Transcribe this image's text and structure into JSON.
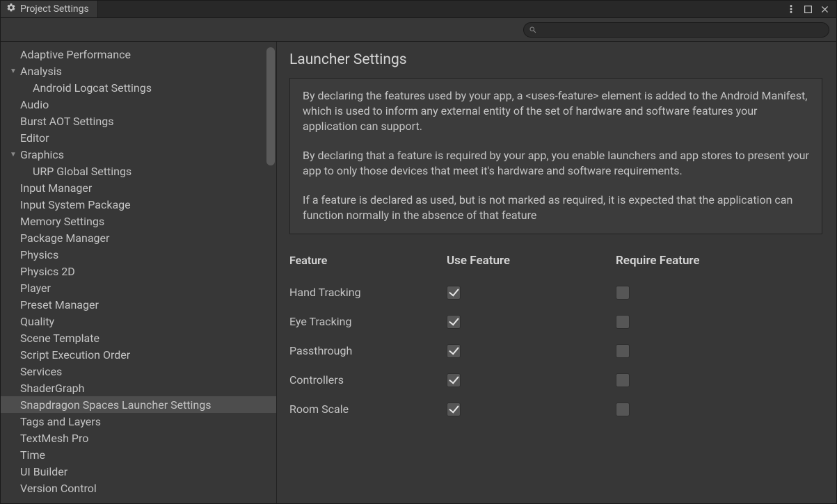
{
  "window": {
    "title": "Project Settings"
  },
  "search": {
    "value": "",
    "placeholder": ""
  },
  "sidebar": {
    "items": [
      {
        "label": "Adaptive Performance",
        "depth": 0,
        "expandable": false,
        "selected": false
      },
      {
        "label": "Analysis",
        "depth": 0,
        "expandable": true,
        "selected": false
      },
      {
        "label": "Android Logcat Settings",
        "depth": 1,
        "expandable": false,
        "selected": false
      },
      {
        "label": "Audio",
        "depth": 0,
        "expandable": false,
        "selected": false
      },
      {
        "label": "Burst AOT Settings",
        "depth": 0,
        "expandable": false,
        "selected": false
      },
      {
        "label": "Editor",
        "depth": 0,
        "expandable": false,
        "selected": false
      },
      {
        "label": "Graphics",
        "depth": 0,
        "expandable": true,
        "selected": false
      },
      {
        "label": "URP Global Settings",
        "depth": 1,
        "expandable": false,
        "selected": false
      },
      {
        "label": "Input Manager",
        "depth": 0,
        "expandable": false,
        "selected": false
      },
      {
        "label": "Input System Package",
        "depth": 0,
        "expandable": false,
        "selected": false
      },
      {
        "label": "Memory Settings",
        "depth": 0,
        "expandable": false,
        "selected": false
      },
      {
        "label": "Package Manager",
        "depth": 0,
        "expandable": false,
        "selected": false
      },
      {
        "label": "Physics",
        "depth": 0,
        "expandable": false,
        "selected": false
      },
      {
        "label": "Physics 2D",
        "depth": 0,
        "expandable": false,
        "selected": false
      },
      {
        "label": "Player",
        "depth": 0,
        "expandable": false,
        "selected": false
      },
      {
        "label": "Preset Manager",
        "depth": 0,
        "expandable": false,
        "selected": false
      },
      {
        "label": "Quality",
        "depth": 0,
        "expandable": false,
        "selected": false
      },
      {
        "label": "Scene Template",
        "depth": 0,
        "expandable": false,
        "selected": false
      },
      {
        "label": "Script Execution Order",
        "depth": 0,
        "expandable": false,
        "selected": false
      },
      {
        "label": "Services",
        "depth": 0,
        "expandable": false,
        "selected": false
      },
      {
        "label": "ShaderGraph",
        "depth": 0,
        "expandable": false,
        "selected": false
      },
      {
        "label": "Snapdragon Spaces Launcher Settings",
        "depth": 0,
        "expandable": false,
        "selected": true
      },
      {
        "label": "Tags and Layers",
        "depth": 0,
        "expandable": false,
        "selected": false
      },
      {
        "label": "TextMesh Pro",
        "depth": 0,
        "expandable": false,
        "selected": false
      },
      {
        "label": "Time",
        "depth": 0,
        "expandable": false,
        "selected": false
      },
      {
        "label": "UI Builder",
        "depth": 0,
        "expandable": false,
        "selected": false
      },
      {
        "label": "Version Control",
        "depth": 0,
        "expandable": false,
        "selected": false
      }
    ]
  },
  "content": {
    "title": "Launcher Settings",
    "info": {
      "p1": "By declaring the features used by your app, a <uses-feature> element is added to the Android Manifest, which is used to inform any external entity of the set of hardware and software features your application can support.",
      "p2": "By declaring that a feature is required by your app, you enable launchers and app stores to present your app to only those devices that meet it's hardware and software requirements.",
      "p3": "If a feature is declared as used, but is not marked as required, it is expected that the application can function normally in the absence of that feature"
    },
    "table": {
      "headers": {
        "feature": "Feature",
        "use": "Use Feature",
        "require": "Require Feature"
      },
      "rows": [
        {
          "name": "Hand Tracking",
          "use": true,
          "require": false
        },
        {
          "name": "Eye Tracking",
          "use": true,
          "require": false
        },
        {
          "name": "Passthrough",
          "use": true,
          "require": false
        },
        {
          "name": "Controllers",
          "use": true,
          "require": false
        },
        {
          "name": "Room Scale",
          "use": true,
          "require": false
        }
      ]
    }
  }
}
